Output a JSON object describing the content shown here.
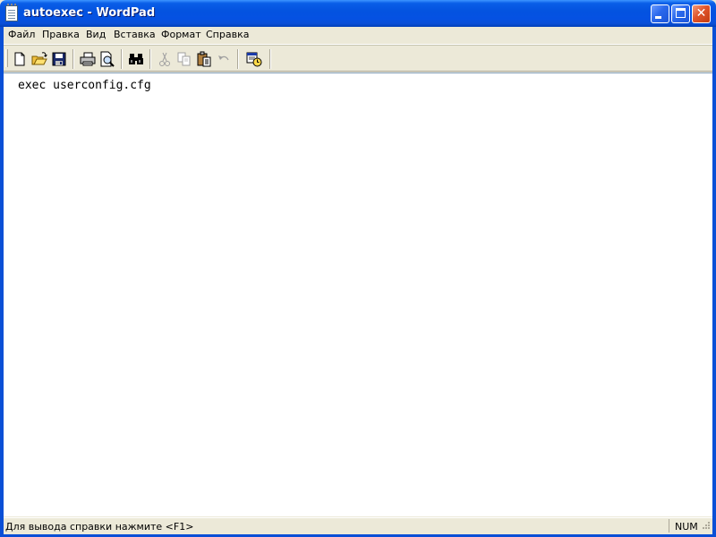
{
  "window": {
    "title": "autoexec - WordPad",
    "app_icon": "wordpad-document-icon"
  },
  "title_buttons": [
    {
      "name": "minimize",
      "icon": "minimize-icon"
    },
    {
      "name": "maximize",
      "icon": "maximize-icon"
    },
    {
      "name": "close",
      "icon": "close-icon"
    }
  ],
  "menubar": {
    "items": [
      "Файл",
      "Правка",
      "Вид",
      "Вставка",
      "Формат",
      "Справка"
    ]
  },
  "toolbar": {
    "buttons": [
      {
        "name": "new",
        "icon": "new-document-icon",
        "enabled": true
      },
      {
        "name": "open",
        "icon": "open-folder-icon",
        "enabled": true
      },
      {
        "name": "save",
        "icon": "floppy-disk-icon",
        "enabled": true
      },
      {
        "name": "print",
        "icon": "printer-icon",
        "enabled": true
      },
      {
        "name": "print-preview",
        "icon": "print-preview-icon",
        "enabled": true
      },
      {
        "name": "find",
        "icon": "binoculars-icon",
        "enabled": true
      },
      {
        "name": "cut",
        "icon": "scissors-icon",
        "enabled": false
      },
      {
        "name": "copy",
        "icon": "copy-icon",
        "enabled": false
      },
      {
        "name": "paste",
        "icon": "paste-icon",
        "enabled": true
      },
      {
        "name": "undo",
        "icon": "undo-icon",
        "enabled": false
      },
      {
        "name": "insert-datetime",
        "icon": "date-time-icon",
        "enabled": true
      }
    ]
  },
  "document": {
    "text": "exec userconfig.cfg"
  },
  "statusbar": {
    "help_text": "Для вывода справки нажмите <F1>",
    "num_indicator": "NUM"
  },
  "colors": {
    "titlebar_blue": "#0453e0",
    "close_red": "#e0542a",
    "chrome": "#ece9d8"
  }
}
